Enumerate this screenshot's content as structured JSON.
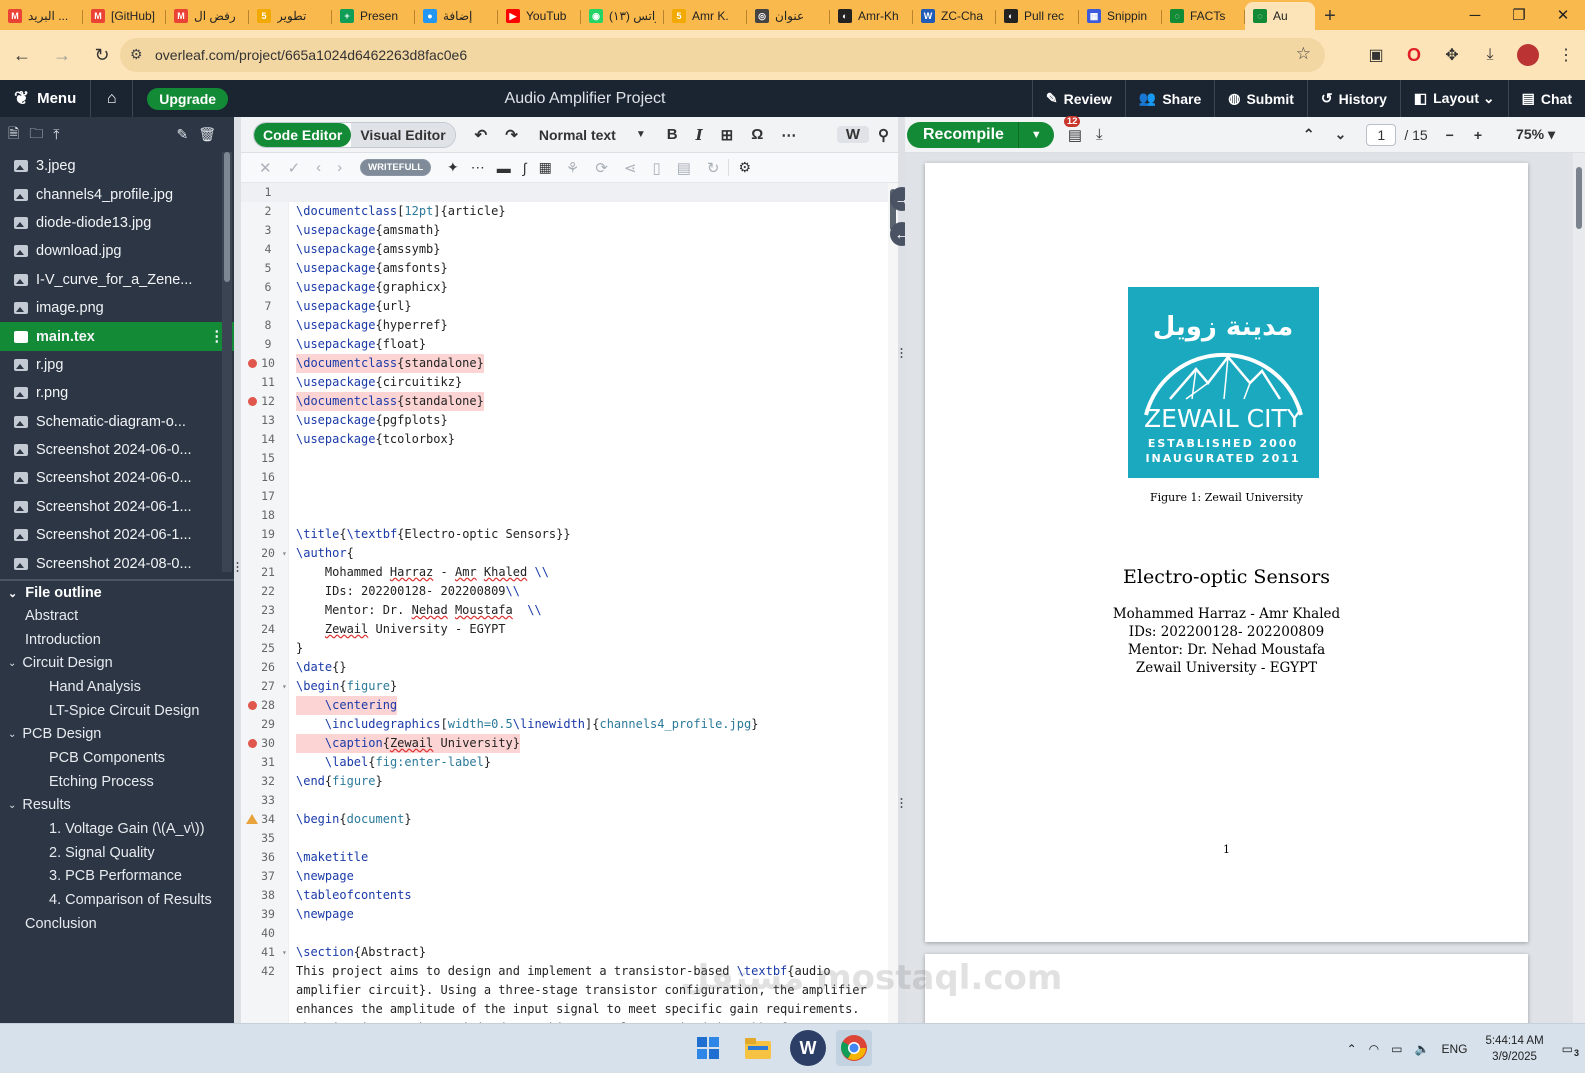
{
  "browser": {
    "tabs": [
      {
        "title": "البريد ...",
        "color": "#ea4335",
        "glyph": "M"
      },
      {
        "title": "[GitHub]",
        "color": "#ea4335",
        "glyph": "M"
      },
      {
        "title": "رفض ال",
        "color": "#ea4335",
        "glyph": "M"
      },
      {
        "title": "تطوير",
        "color": "#f2a900",
        "glyph": "5"
      },
      {
        "title": "Presen",
        "color": "#0f9d58",
        "glyph": "+"
      },
      {
        "title": "إضافة",
        "color": "#2196f3",
        "glyph": "●"
      },
      {
        "title": "YouTub",
        "color": "#ff0000",
        "glyph": "▶"
      },
      {
        "title": "(١٣) واتس",
        "color": "#25d366",
        "glyph": "◉"
      },
      {
        "title": "Amr K.",
        "color": "#f2a900",
        "glyph": "5"
      },
      {
        "title": "عنوان",
        "color": "#444444",
        "glyph": "◎"
      },
      {
        "title": "Amr-Kh",
        "color": "#222222",
        "glyph": "◐"
      },
      {
        "title": "ZC-Cha",
        "color": "#1f5bb8",
        "glyph": "W"
      },
      {
        "title": "Pull rec",
        "color": "#222222",
        "glyph": "◐"
      },
      {
        "title": "Snippin",
        "color": "#3b5bdb",
        "glyph": "▦"
      },
      {
        "title": "FACTs",
        "color": "#138a36",
        "glyph": "◌"
      },
      {
        "title": "Au",
        "color": "#138a36",
        "glyph": "◌",
        "active": true
      }
    ],
    "new_tab": "+",
    "win": {
      "min": "─",
      "max": "❐",
      "close": "✕"
    },
    "nav": {
      "back": "←",
      "forward": "→",
      "reload": "↻"
    },
    "url": "overleaf.com/project/665a1024d6462263d8fac0e6",
    "tune_icon": "⚙",
    "star_icon": "☆"
  },
  "overleaf": {
    "menu": "Menu",
    "upgrade": "Upgrade",
    "project_title": "Audio Amplifier Project",
    "actions": [
      {
        "name": "review-button",
        "icon": "✎",
        "label": "Review"
      },
      {
        "name": "share-button",
        "icon": "👥",
        "label": "Share"
      },
      {
        "name": "submit-button",
        "icon": "◍",
        "label": "Submit"
      },
      {
        "name": "history-button",
        "icon": "↺",
        "label": "History"
      },
      {
        "name": "layout-button",
        "icon": "◧",
        "label": "Layout ⌄"
      },
      {
        "name": "chat-button",
        "icon": "▤",
        "label": "Chat"
      }
    ]
  },
  "files": [
    {
      "label": "3.jpeg",
      "type": "img"
    },
    {
      "label": "channels4_profile.jpg",
      "type": "img"
    },
    {
      "label": "diode-diode13.jpg",
      "type": "img"
    },
    {
      "label": "download.jpg",
      "type": "img"
    },
    {
      "label": "I-V_curve_for_a_Zene...",
      "type": "img"
    },
    {
      "label": "image.png",
      "type": "img"
    },
    {
      "label": "main.tex",
      "type": "doc",
      "selected": true
    },
    {
      "label": "r.jpg",
      "type": "img"
    },
    {
      "label": "r.png",
      "type": "img"
    },
    {
      "label": "Schematic-diagram-o...",
      "type": "img"
    },
    {
      "label": "Screenshot 2024-06-0...",
      "type": "img"
    },
    {
      "label": "Screenshot 2024-06-0...",
      "type": "img"
    },
    {
      "label": "Screenshot 2024-06-1...",
      "type": "img"
    },
    {
      "label": "Screenshot 2024-06-1...",
      "type": "img"
    },
    {
      "label": "Screenshot 2024-08-0...",
      "type": "img"
    }
  ],
  "outline": {
    "title": "File outline",
    "items": [
      {
        "label": "Abstract",
        "level": 1
      },
      {
        "label": "Introduction",
        "level": 1
      },
      {
        "label": "Circuit Design",
        "level": 1,
        "expanded": true
      },
      {
        "label": "Hand Analysis",
        "level": 2
      },
      {
        "label": "LT-Spice Circuit Design",
        "level": 2
      },
      {
        "label": "PCB Design",
        "level": 1,
        "expanded": true
      },
      {
        "label": "PCB Components",
        "level": 2
      },
      {
        "label": "Etching Process",
        "level": 2
      },
      {
        "label": "Results",
        "level": 1,
        "expanded": true
      },
      {
        "label": "1. Voltage Gain (\\(A_v\\))",
        "level": 2
      },
      {
        "label": "2. Signal Quality",
        "level": 2
      },
      {
        "label": "3. PCB Performance",
        "level": 2
      },
      {
        "label": "4. Comparison of Results",
        "level": 2
      },
      {
        "label": "Conclusion",
        "level": 1
      }
    ]
  },
  "editor": {
    "code_editor": "Code Editor",
    "visual_editor": "Visual Editor",
    "style_select": "Normal text",
    "writefull": "WRITEFULL",
    "lines": [
      {
        "n": "1",
        "t": ""
      },
      {
        "n": "2",
        "t": "\\documentclass[12pt]{article}"
      },
      {
        "n": "3",
        "t": "\\usepackage{amsmath}"
      },
      {
        "n": "4",
        "t": "\\usepackage{amssymb}"
      },
      {
        "n": "5",
        "t": "\\usepackage{amsfonts}"
      },
      {
        "n": "6",
        "t": "\\usepackage{graphicx}"
      },
      {
        "n": "7",
        "t": "\\usepackage{url}"
      },
      {
        "n": "8",
        "t": "\\usepackage{hyperref}"
      },
      {
        "n": "9",
        "t": "\\usepackage{float}"
      },
      {
        "n": "10",
        "t": "\\documentclass{standalone}",
        "mark": "err"
      },
      {
        "n": "11",
        "t": "\\usepackage{circuitikz}"
      },
      {
        "n": "12",
        "t": "\\documentclass{standalone}",
        "mark": "err"
      },
      {
        "n": "13",
        "t": "\\usepackage{pgfplots}"
      },
      {
        "n": "14",
        "t": "\\usepackage{tcolorbox}"
      },
      {
        "n": "15",
        "t": ""
      },
      {
        "n": "16",
        "t": ""
      },
      {
        "n": "17",
        "t": ""
      },
      {
        "n": "18",
        "t": ""
      },
      {
        "n": "19",
        "t": "\\title{\\textbf{Electro-optic Sensors}}"
      },
      {
        "n": "20",
        "t": "\\author{",
        "fold": true
      },
      {
        "n": "21",
        "t": "    Mohammed Harraz - Amr Khaled \\\\"
      },
      {
        "n": "22",
        "t": "    IDs: 202200128- 202200809\\\\"
      },
      {
        "n": "23",
        "t": "    Mentor: Dr. Nehad Moustafa  \\\\"
      },
      {
        "n": "24",
        "t": "    Zewail University - EGYPT"
      },
      {
        "n": "25",
        "t": "}"
      },
      {
        "n": "26",
        "t": "\\date{}"
      },
      {
        "n": "27",
        "t": "\\begin{figure}",
        "fold": true
      },
      {
        "n": "28",
        "t": "    \\centering",
        "mark": "err"
      },
      {
        "n": "29",
        "t": "    \\includegraphics[width=0.5\\linewidth]{channels4_profile.jpg}"
      },
      {
        "n": "30",
        "t": "    \\caption{Zewail University}",
        "mark": "err"
      },
      {
        "n": "31",
        "t": "    \\label{fig:enter-label}"
      },
      {
        "n": "32",
        "t": "\\end{figure}"
      },
      {
        "n": "33",
        "t": ""
      },
      {
        "n": "34",
        "t": "\\begin{document}",
        "mark": "warn"
      },
      {
        "n": "35",
        "t": ""
      },
      {
        "n": "36",
        "t": "\\maketitle"
      },
      {
        "n": "37",
        "t": "\\newpage"
      },
      {
        "n": "38",
        "t": "\\tableofcontents"
      },
      {
        "n": "39",
        "t": "\\newpage"
      },
      {
        "n": "40",
        "t": ""
      },
      {
        "n": "41",
        "t": "\\section{Abstract}",
        "fold": true
      },
      {
        "n": "42",
        "t": "This project aims to design and implement a transistor-based \\textbf{audio"
      },
      {
        "n": "",
        "t": "amplifier circuit}. Using a three-stage transistor configuration, the amplifier"
      },
      {
        "n": "",
        "t": "enhances the amplitude of the input signal to meet specific gain requirements."
      },
      {
        "n": "",
        "t": "The circuit must be optimized to achieve a voltage gain (\\(A_v\\)) of"
      }
    ]
  },
  "pdf": {
    "recompile": "Recompile",
    "errors": "12",
    "page": "1",
    "pages": "/ 15",
    "zoom": "75%",
    "logo_arabic": "مدينة زويل",
    "logo_name": "ZEWAIL CITY",
    "logo_est": "ESTABLISHED 2000",
    "logo_inaug": "INAUGURATED 2011",
    "figure_caption": "Figure 1: Zewail University",
    "title": "Electro-optic Sensors",
    "authors": "Mohammed Harraz - Amr Khaled",
    "ids": "IDs: 202200128- 202200809",
    "mentor": "Mentor: Dr. Nehad Moustafa",
    "affil": "Zewail University - EGYPT",
    "page_number": "1"
  },
  "taskbar": {
    "lang": "ENG",
    "time": "5:44:14 AM",
    "date": "3/9/2025",
    "notif": "3"
  },
  "watermark": "مستقل mostaql.com"
}
